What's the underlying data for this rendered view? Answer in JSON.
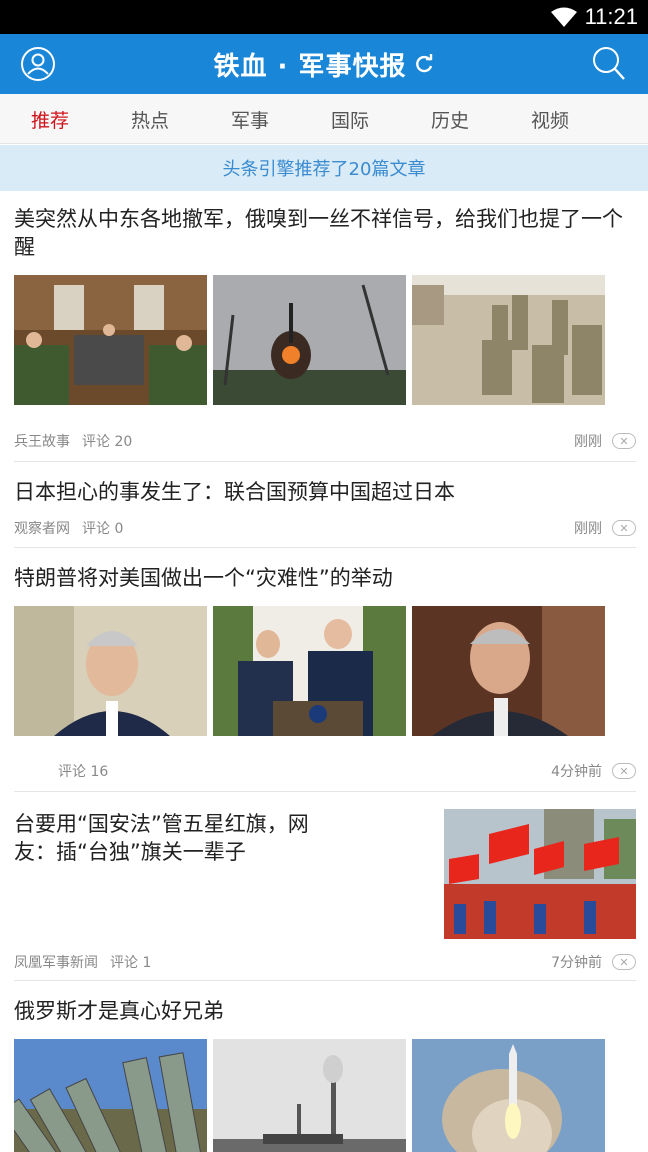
{
  "status": {
    "time": "11:21"
  },
  "appbar": {
    "title": "铁血 · 军事快报"
  },
  "tabs": [
    "推荐",
    "热点",
    "军事",
    "国际",
    "历史",
    "视频"
  ],
  "banner": "头条引擎推荐了20篇文章",
  "articles": [
    {
      "title": "美突然从中东各地撤军，俄嗅到一丝不祥信号，给我们也提了一个醒",
      "source": "兵王故事",
      "comments": "评论 20",
      "time": "刚刚"
    },
    {
      "title": "日本担心的事发生了：联合国预算中国超过日本",
      "source": "观察者网",
      "comments": "评论 0",
      "time": "刚刚"
    },
    {
      "title": "特朗普将对美国做出一个“灾难性”的举动",
      "source": "",
      "comments": "评论 16",
      "time": "4分钟前"
    },
    {
      "title": "台要用“国安法”管五星红旗，网友：插“台独”旗关一辈子",
      "source": "凤凰军事新闻",
      "comments": "评论 1",
      "time": "7分钟前"
    },
    {
      "title": "俄罗斯才是真心好兄弟"
    }
  ],
  "colors": {
    "appbar": "#1a86d8",
    "active_tab": "#d0121b",
    "banner_bg": "#d9ebf7",
    "banner_text": "#3a8bd0"
  }
}
